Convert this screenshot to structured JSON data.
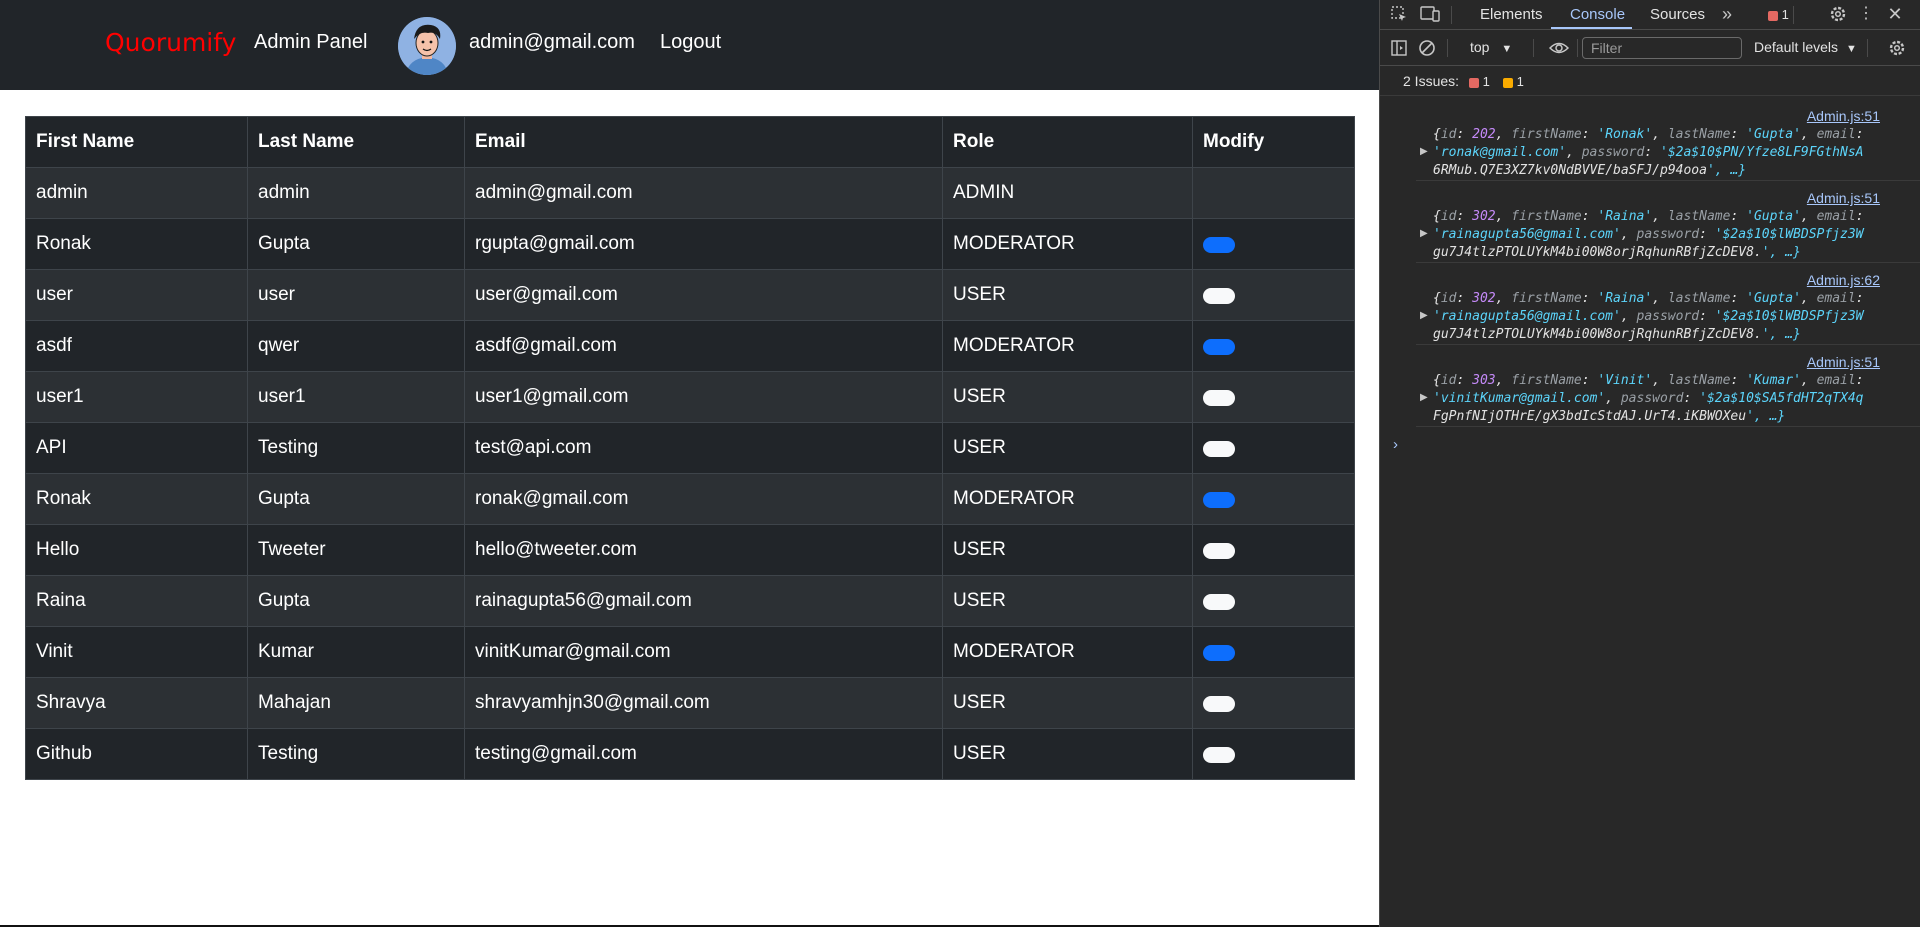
{
  "navbar": {
    "brand": "Quorumify",
    "admin_panel": "Admin Panel",
    "user_email": "admin@gmail.com",
    "logout": "Logout"
  },
  "table": {
    "headers": [
      "First Name",
      "Last Name",
      "Email",
      "Role",
      "Modify"
    ],
    "rows": [
      {
        "first": "admin",
        "last": "admin",
        "email": "admin@gmail.com",
        "role": "ADMIN",
        "toggle": "none"
      },
      {
        "first": "Ronak",
        "last": "Gupta",
        "email": "rgupta@gmail.com",
        "role": "MODERATOR",
        "toggle": "on"
      },
      {
        "first": "user",
        "last": "user",
        "email": "user@gmail.com",
        "role": "USER",
        "toggle": "off"
      },
      {
        "first": "asdf",
        "last": "qwer",
        "email": "asdf@gmail.com",
        "role": "MODERATOR",
        "toggle": "on"
      },
      {
        "first": "user1",
        "last": "user1",
        "email": "user1@gmail.com",
        "role": "USER",
        "toggle": "off"
      },
      {
        "first": "API",
        "last": "Testing",
        "email": "test@api.com",
        "role": "USER",
        "toggle": "off"
      },
      {
        "first": "Ronak",
        "last": "Gupta",
        "email": "ronak@gmail.com",
        "role": "MODERATOR",
        "toggle": "on"
      },
      {
        "first": "Hello",
        "last": "Tweeter",
        "email": "hello@tweeter.com",
        "role": "USER",
        "toggle": "off"
      },
      {
        "first": "Raina",
        "last": "Gupta",
        "email": "rainagupta56@gmail.com",
        "role": "USER",
        "toggle": "off"
      },
      {
        "first": "Vinit",
        "last": "Kumar",
        "email": "vinitKumar@gmail.com",
        "role": "MODERATOR",
        "toggle": "on"
      },
      {
        "first": "Shravya",
        "last": "Mahajan",
        "email": "shravyamhjn30@gmail.com",
        "role": "USER",
        "toggle": "off"
      },
      {
        "first": "Github",
        "last": "Testing",
        "email": "testing@gmail.com",
        "role": "USER",
        "toggle": "off"
      }
    ]
  },
  "devtools": {
    "tabs": [
      "Elements",
      "Console",
      "Sources"
    ],
    "active_tab": "Console",
    "error_count": "1",
    "context": "top",
    "filter_placeholder": "Filter",
    "levels": "Default levels",
    "issues_label": "2 Issues:",
    "issues_errors": "1",
    "issues_warnings": "1",
    "logs": [
      {
        "source": "Admin.js:51",
        "line1": "{id: 202, firstName: 'Ronak', lastName: 'Gupta', email:",
        "line2": "'ronak@gmail.com', password: '$2a$10$PN/Yfze8LF9FGthNsA",
        "line3": "6RMub.Q7E3XZ7kv0NdBVVE/baSFJ/p94ooa', …}"
      },
      {
        "source": "Admin.js:51",
        "line1": "{id: 302, firstName: 'Raina', lastName: 'Gupta', email:",
        "line2": "'rainagupta56@gmail.com', password: '$2a$10$lWBDSPfjz3W",
        "line3": "gu7J4tlzPTOLUYkM4bi00W8orjRqhunRBfjZcDEV8.', …}"
      },
      {
        "source": "Admin.js:62",
        "line1": "{id: 302, firstName: 'Raina', lastName: 'Gupta', email:",
        "line2": "'rainagupta56@gmail.com', password: '$2a$10$lWBDSPfjz3W",
        "line3": "gu7J4tlzPTOLUYkM4bi00W8orjRqhunRBfjZcDEV8.', …}"
      },
      {
        "source": "Admin.js:51",
        "line1": "{id: 303, firstName: 'Vinit', lastName: 'Kumar', email:",
        "line2": "'vinitKumar@gmail.com', password: '$2a$10$SA5fdHT2qTX4q",
        "line3": "FgPnfNIjOTHrE/gX3bdIcStdAJ.UrT4.iKBWOXeu', …}"
      }
    ]
  }
}
